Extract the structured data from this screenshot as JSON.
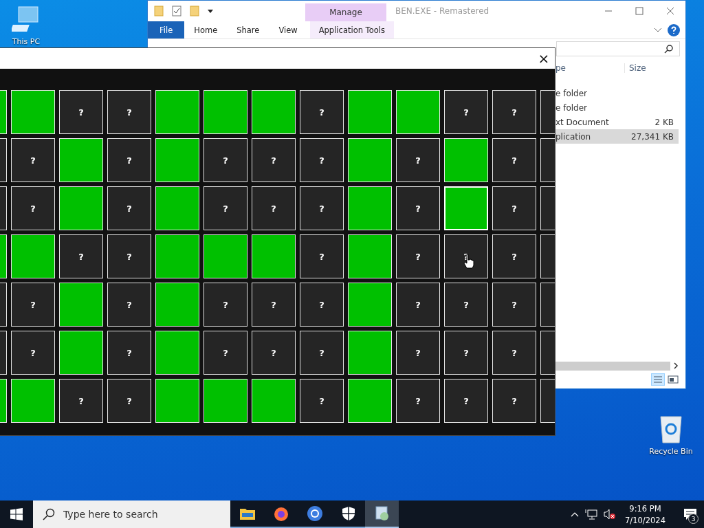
{
  "desktop": {
    "icons": [
      {
        "kind": "pc",
        "label": "This PC"
      },
      {
        "kind": "bin",
        "label": "Recycle Bin"
      }
    ]
  },
  "explorer": {
    "context_group": "Manage",
    "title": "BEN.EXE - Remastered",
    "tabs": [
      {
        "label": "File",
        "kind": "file"
      },
      {
        "label": "Home",
        "kind": "normal"
      },
      {
        "label": "Share",
        "kind": "normal"
      },
      {
        "label": "View",
        "kind": "normal"
      },
      {
        "label": "Application Tools",
        "kind": "context"
      }
    ],
    "columns": [
      "pe",
      "Size"
    ],
    "files": [
      {
        "type": "e folder",
        "selected": false
      },
      {
        "type": "e folder",
        "selected": false
      },
      {
        "type": "xt Document",
        "size": "2 KB",
        "selected": false
      },
      {
        "type": "plication",
        "size": "27,341 KB",
        "selected": true
      }
    ]
  },
  "game": {
    "close": "×",
    "rows": [
      [
        {
          "revealed": true,
          "highlighted": false
        },
        {
          "revealed": true,
          "highlighted": false
        },
        {
          "revealed": false,
          "highlighted": false,
          "text": "?"
        },
        {
          "revealed": false,
          "highlighted": false,
          "text": "?"
        },
        {
          "revealed": true,
          "highlighted": false
        },
        {
          "revealed": true,
          "highlighted": false
        },
        {
          "revealed": true,
          "highlighted": false
        },
        {
          "revealed": false,
          "highlighted": false,
          "text": "?"
        },
        {
          "revealed": true,
          "highlighted": false
        },
        {
          "revealed": true,
          "highlighted": false
        },
        {
          "revealed": false,
          "highlighted": false,
          "text": "?"
        },
        {
          "revealed": false,
          "highlighted": false,
          "text": "?"
        },
        {
          "revealed": false,
          "highlighted": false
        }
      ],
      [
        {
          "revealed": false,
          "highlighted": false
        },
        {
          "revealed": false,
          "highlighted": false,
          "text": "?"
        },
        {
          "revealed": true,
          "highlighted": false
        },
        {
          "revealed": false,
          "highlighted": false,
          "text": "?"
        },
        {
          "revealed": true,
          "highlighted": false
        },
        {
          "revealed": false,
          "highlighted": false,
          "text": "?"
        },
        {
          "revealed": false,
          "highlighted": false,
          "text": "?"
        },
        {
          "revealed": false,
          "highlighted": false,
          "text": "?"
        },
        {
          "revealed": true,
          "highlighted": false
        },
        {
          "revealed": false,
          "highlighted": false,
          "text": "?"
        },
        {
          "revealed": true,
          "highlighted": false
        },
        {
          "revealed": false,
          "highlighted": false,
          "text": "?"
        },
        {
          "revealed": false,
          "highlighted": false
        }
      ],
      [
        {
          "revealed": false,
          "highlighted": false
        },
        {
          "revealed": false,
          "highlighted": false,
          "text": "?"
        },
        {
          "revealed": true,
          "highlighted": false
        },
        {
          "revealed": false,
          "highlighted": false,
          "text": "?"
        },
        {
          "revealed": true,
          "highlighted": false
        },
        {
          "revealed": false,
          "highlighted": false,
          "text": "?"
        },
        {
          "revealed": false,
          "highlighted": false,
          "text": "?"
        },
        {
          "revealed": false,
          "highlighted": false,
          "text": "?"
        },
        {
          "revealed": true,
          "highlighted": false
        },
        {
          "revealed": false,
          "highlighted": false,
          "text": "?"
        },
        {
          "revealed": true,
          "highlighted": true
        },
        {
          "revealed": false,
          "highlighted": false,
          "text": "?"
        },
        {
          "revealed": false,
          "highlighted": false
        }
      ],
      [
        {
          "revealed": true,
          "highlighted": false
        },
        {
          "revealed": true,
          "highlighted": false
        },
        {
          "revealed": false,
          "highlighted": false,
          "text": "?"
        },
        {
          "revealed": false,
          "highlighted": false,
          "text": "?"
        },
        {
          "revealed": true,
          "highlighted": false
        },
        {
          "revealed": true,
          "highlighted": false
        },
        {
          "revealed": true,
          "highlighted": false
        },
        {
          "revealed": false,
          "highlighted": false,
          "text": "?"
        },
        {
          "revealed": true,
          "highlighted": false
        },
        {
          "revealed": false,
          "highlighted": false,
          "text": "?"
        },
        {
          "revealed": false,
          "highlighted": false,
          "text": "?"
        },
        {
          "revealed": false,
          "highlighted": false,
          "text": "?"
        },
        {
          "revealed": false,
          "highlighted": false
        }
      ],
      [
        {
          "revealed": false,
          "highlighted": false
        },
        {
          "revealed": false,
          "highlighted": false,
          "text": "?"
        },
        {
          "revealed": true,
          "highlighted": false
        },
        {
          "revealed": false,
          "highlighted": false,
          "text": "?"
        },
        {
          "revealed": true,
          "highlighted": false
        },
        {
          "revealed": false,
          "highlighted": false,
          "text": "?"
        },
        {
          "revealed": false,
          "highlighted": false,
          "text": "?"
        },
        {
          "revealed": false,
          "highlighted": false,
          "text": "?"
        },
        {
          "revealed": true,
          "highlighted": false
        },
        {
          "revealed": false,
          "highlighted": false,
          "text": "?"
        },
        {
          "revealed": false,
          "highlighted": false,
          "text": "?"
        },
        {
          "revealed": false,
          "highlighted": false,
          "text": "?"
        },
        {
          "revealed": false,
          "highlighted": false
        }
      ],
      [
        {
          "revealed": false,
          "highlighted": false
        },
        {
          "revealed": false,
          "highlighted": false,
          "text": "?"
        },
        {
          "revealed": true,
          "highlighted": false
        },
        {
          "revealed": false,
          "highlighted": false,
          "text": "?"
        },
        {
          "revealed": true,
          "highlighted": false
        },
        {
          "revealed": false,
          "highlighted": false,
          "text": "?"
        },
        {
          "revealed": false,
          "highlighted": false,
          "text": "?"
        },
        {
          "revealed": false,
          "highlighted": false,
          "text": "?"
        },
        {
          "revealed": true,
          "highlighted": false
        },
        {
          "revealed": false,
          "highlighted": false,
          "text": "?"
        },
        {
          "revealed": false,
          "highlighted": false,
          "text": "?"
        },
        {
          "revealed": false,
          "highlighted": false,
          "text": "?"
        },
        {
          "revealed": false,
          "highlighted": false
        }
      ],
      [
        {
          "revealed": true,
          "highlighted": false
        },
        {
          "revealed": true,
          "highlighted": false
        },
        {
          "revealed": false,
          "highlighted": false,
          "text": "?"
        },
        {
          "revealed": false,
          "highlighted": false,
          "text": "?"
        },
        {
          "revealed": true,
          "highlighted": false
        },
        {
          "revealed": true,
          "highlighted": false
        },
        {
          "revealed": true,
          "highlighted": false
        },
        {
          "revealed": false,
          "highlighted": false,
          "text": "?"
        },
        {
          "revealed": true,
          "highlighted": false
        },
        {
          "revealed": false,
          "highlighted": false,
          "text": "?"
        },
        {
          "revealed": false,
          "highlighted": false,
          "text": "?"
        },
        {
          "revealed": false,
          "highlighted": false,
          "text": "?"
        },
        {
          "revealed": false,
          "highlighted": false
        }
      ]
    ]
  },
  "taskbar": {
    "search_placeholder": "Type here to search",
    "apps": [
      {
        "kind": "folder",
        "selected": false
      },
      {
        "kind": "firefox",
        "selected": false
      },
      {
        "kind": "chrome",
        "selected": false
      },
      {
        "kind": "shield",
        "selected": false
      },
      {
        "kind": "game",
        "selected": true
      }
    ],
    "time": "9:16 PM",
    "date": "7/10/2024",
    "notifications": "3"
  }
}
